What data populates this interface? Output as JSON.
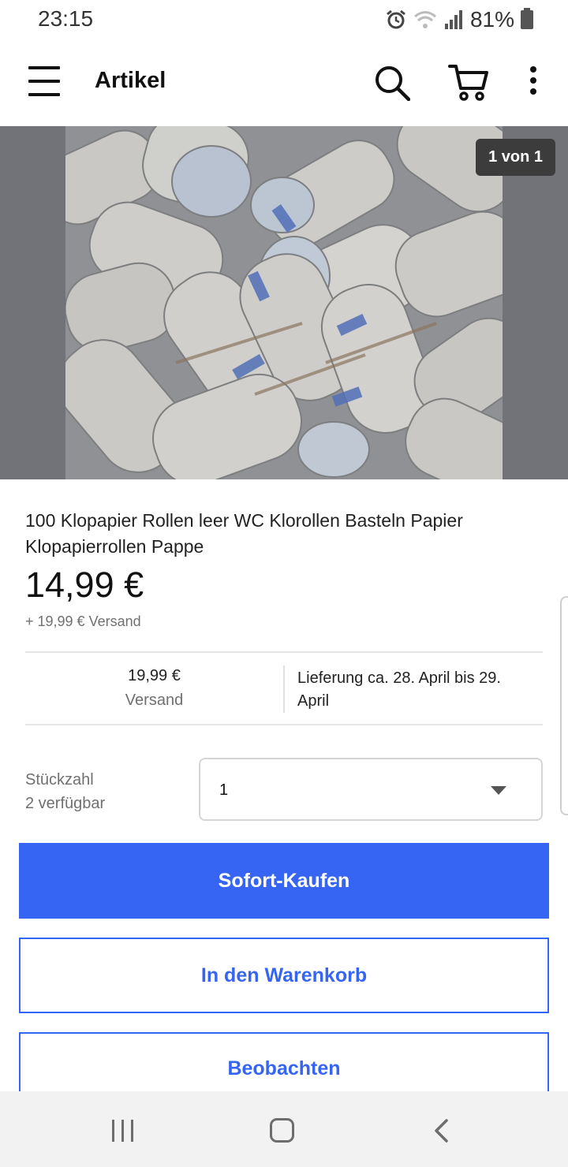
{
  "status_bar": {
    "time": "23:15",
    "battery": "81%"
  },
  "app_bar": {
    "title": "Artikel"
  },
  "gallery": {
    "counter": "1 von 1"
  },
  "item": {
    "title": "100 Klopapier Rollen leer WC Klorollen Basteln Papier Klopapierrollen Pappe",
    "price": "14,99 €",
    "shipping_line": "+ 19,99 € Versand"
  },
  "info": {
    "shipping_amount": "19,99 €",
    "shipping_label": "Versand",
    "delivery": "Lieferung ca. 28. April bis 29. April"
  },
  "quantity": {
    "label": "Stückzahl",
    "available": "2 verfügbar",
    "value": "1"
  },
  "buttons": {
    "buy_now": "Sofort-Kaufen",
    "add_to_cart": "In den Warenkorb",
    "watch": "Beobachten"
  },
  "colors": {
    "accent": "#3665f3",
    "gallery_bg": "#727378"
  },
  "icons": [
    "menu-icon",
    "search-icon",
    "cart-icon",
    "more-icon",
    "alarm-icon",
    "wifi-icon",
    "signal-icon",
    "battery-icon",
    "chevron-down-icon",
    "nav-recents-icon",
    "nav-home-icon",
    "nav-back-icon"
  ]
}
